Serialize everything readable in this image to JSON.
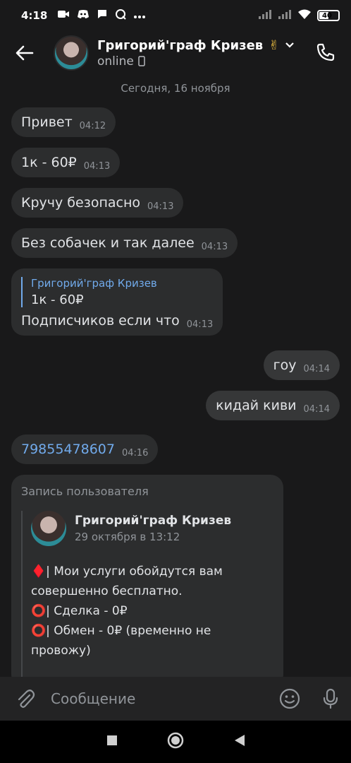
{
  "status_bar": {
    "time": "4:18",
    "battery": "40"
  },
  "header": {
    "contact_name": "Григорий'граф Кризев",
    "name_emoji": "✌",
    "status": "online"
  },
  "chat": {
    "date_separator": "Сегодня, 16 ноября",
    "messages": [
      {
        "text": "Привет",
        "time": "04:12"
      },
      {
        "text": "1к - 60₽",
        "time": "04:13"
      },
      {
        "text": "Кручу безопасно",
        "time": "04:13"
      },
      {
        "text": "Без собачек и так далее",
        "time": "04:13"
      },
      {
        "reply_name": "Григорий'граф Кризев",
        "reply_text": "1к - 60₽",
        "text": "Подписчиков если что",
        "time": "04:13"
      },
      {
        "text": "гоу",
        "time": "04:14"
      },
      {
        "text": "кидай киви",
        "time": "04:14"
      },
      {
        "text": "79855478607",
        "time": "04:16"
      }
    ],
    "post": {
      "title": "Запись пользователя",
      "author": "Григорий'граф Кризев",
      "date": "29 октября в 13:12",
      "body": "♦️| Мои услуги обойдутся вам совершенно бесплатно.\n⭕| Сделка - 0₽\n⭕| Обмен - 0₽ (временно не провожу)\n\n🍀| Мои реквизиты :"
    }
  },
  "composer": {
    "placeholder": "Сообщение"
  },
  "colors": {
    "background": "#19191a",
    "bubble": "#2c2d2e",
    "accent": "#71aaeb",
    "secondary_text": "#909499"
  }
}
